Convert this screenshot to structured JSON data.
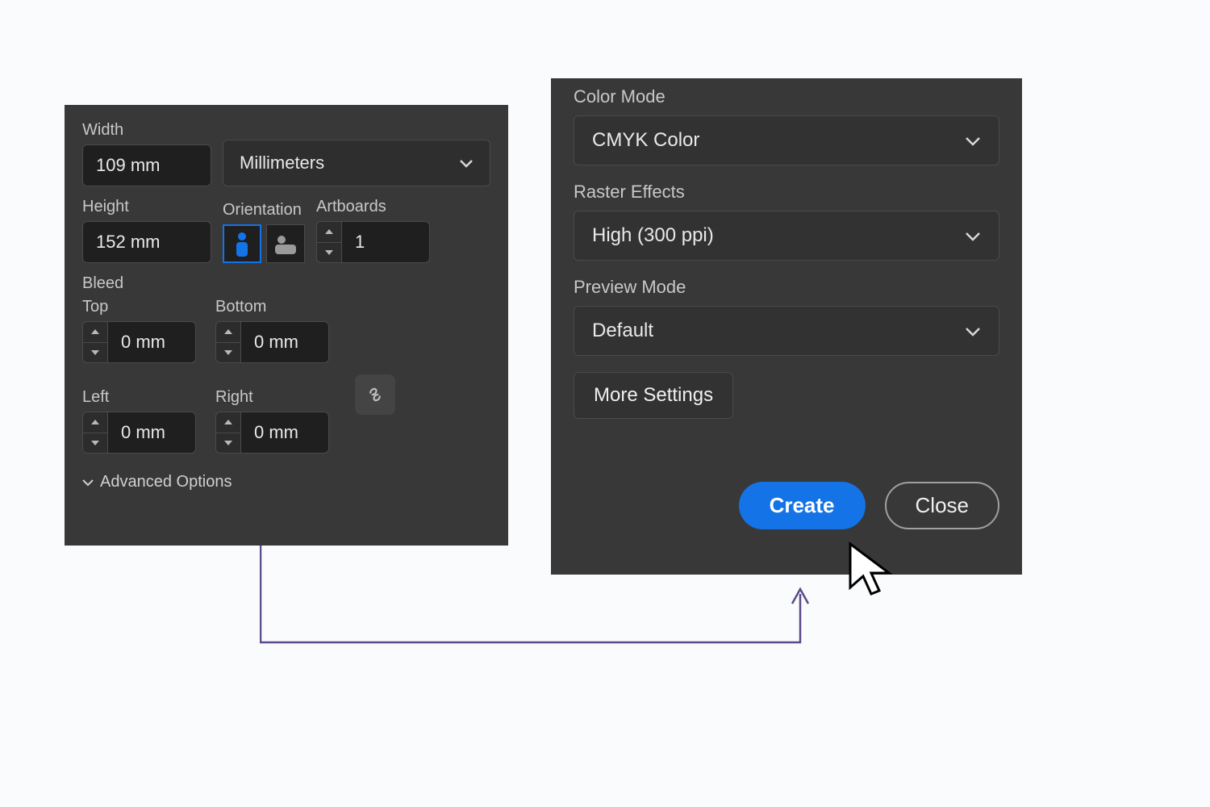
{
  "left": {
    "width_label": "Width",
    "width_value": "109 mm",
    "units_value": "Millimeters",
    "height_label": "Height",
    "height_value": "152 mm",
    "orientation_label": "Orientation",
    "artboards_label": "Artboards",
    "artboards_value": "1",
    "bleed_label": "Bleed",
    "top_label": "Top",
    "top_value": "0 mm",
    "bottom_label": "Bottom",
    "bottom_value": "0 mm",
    "left_label": "Left",
    "left_value": "0 mm",
    "right_label": "Right",
    "right_value": "0 mm",
    "advanced_label": "Advanced Options"
  },
  "right": {
    "color_mode_label": "Color Mode",
    "color_mode_value": "CMYK Color",
    "raster_label": "Raster Effects",
    "raster_value": "High (300 ppi)",
    "preview_label": "Preview Mode",
    "preview_value": "Default",
    "more_label": "More Settings",
    "create_label": "Create",
    "close_label": "Close"
  }
}
